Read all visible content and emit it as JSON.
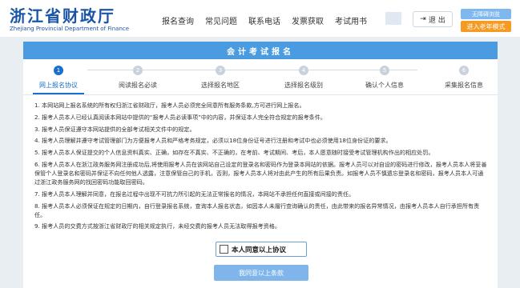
{
  "header": {
    "logo_title": "浙江省财政厅",
    "logo_subtitle": "Zhejiang Provincial Department of Finance",
    "nav": [
      "报名查询",
      "常见问题",
      "联系电话",
      "发票获取",
      "考试用书"
    ],
    "logout_label": "退 出",
    "accessibility_label": "无障碍浏览",
    "elder_mode_label": "进入老年模式"
  },
  "card": {
    "title": "会计考试报名",
    "steps": [
      {
        "num": "1",
        "label": "网上报名协议",
        "active": true
      },
      {
        "num": "2",
        "label": "阅读报名必读",
        "active": false
      },
      {
        "num": "3",
        "label": "选择报名地区",
        "active": false
      },
      {
        "num": "4",
        "label": "选择报名级别",
        "active": false
      },
      {
        "num": "5",
        "label": "确认个人信息",
        "active": false
      },
      {
        "num": "6",
        "label": "采集报名信息",
        "active": false
      }
    ],
    "terms": [
      "1. 本网站网上报名系统的所有权归浙江省财政厅，报考人员必须完全同意所有服务条款,方可进行网上报名。",
      "2. 报考人员本人已经认真阅读本网站中提供的“报考人员必读事项”中的内容，并保证本人完全符合规定的报考条件。",
      "3. 报考人员保证遵守本网站提供的全部考试相关文件中的规定。",
      "4. 报考人员理解并遵守考试管理部门为方便报考人员和严格考务规定，必须以18位身份证号进行注册和考试中也必须使用18位身份证的要求。",
      "5. 报考人员本人保证提交的个人信息资料真实、正确，如存在不真实、不正确的，在考前、考试期间、考后，本人愿意随时接受考试管理机构作出的相应处罚。",
      "6. 报考人员本人在浙江政务服务网注册成功后,将使用报考人员在该网站自己设定的登录名和密码作为登录本网站的依据。报考人员可以对自设的密码进行修改，报考人员本人将妥善保管个人登录名和密码并保证不向任何他人透露，注意保管自己的手机，否则，报考人员本人将对由此产生的所有后果负责。如报考人员不慎遗忘登录名和密码，报考人员本人可通过浙江政务服务网的找回密码功能取回密码。",
      "7. 报考人员本人理解并同意，在报名过程中出现不可抗力所引起的无法正常报名的情况，本网站不承担任何直接或间接的责任。",
      "8. 报考人员本人必须保证在规定的日期内，自行登录报名系统，查询本人报名状态，如因本人未履行查询确认的责任，由此带来的报名异常情况，由报考人员本人自行承担所有责任。",
      "9. 报考人员的交费方式按浙江省财政厅的相关规定执行，未经交费的报考人员无法取得报考资格。"
    ],
    "agree_label": "本人同意以上协议",
    "submit_label": "我同意以上条款"
  }
}
